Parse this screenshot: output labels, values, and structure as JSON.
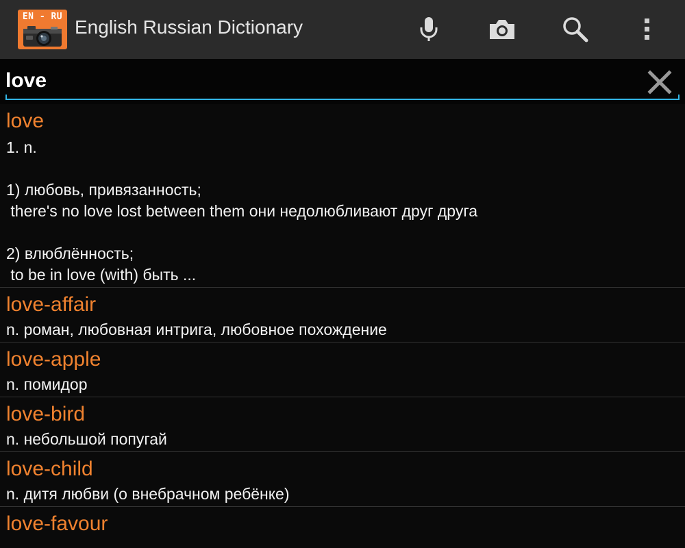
{
  "app": {
    "title": "English Russian Dictionary",
    "icon_label": "EN - RU",
    "accent_color": "#f07a30",
    "focus_color": "#33b5e5"
  },
  "actions": [
    {
      "name": "mic-icon",
      "label": "voice search"
    },
    {
      "name": "camera-icon",
      "label": "camera"
    },
    {
      "name": "search-icon",
      "label": "search"
    },
    {
      "name": "overflow-menu-icon",
      "label": "more options"
    }
  ],
  "search": {
    "value": "love"
  },
  "entries": [
    {
      "word": "love",
      "definition": "1. n.\n\n1) любовь, привязанность;\n there's no love lost between them они недолюбливают друг друга\n\n2) влюблённость;\n to be in love (with) быть ..."
    },
    {
      "word": "love-affair",
      "definition": "n. роман, любовная интрига, любовное похождение"
    },
    {
      "word": "love-apple",
      "definition": "n. помидор"
    },
    {
      "word": "love-bird",
      "definition": "n. небольшой попугай"
    },
    {
      "word": "love-child",
      "definition": "n. дитя любви (о внебрачном ребёнке)"
    },
    {
      "word": "love-favour",
      "definition": ""
    }
  ]
}
